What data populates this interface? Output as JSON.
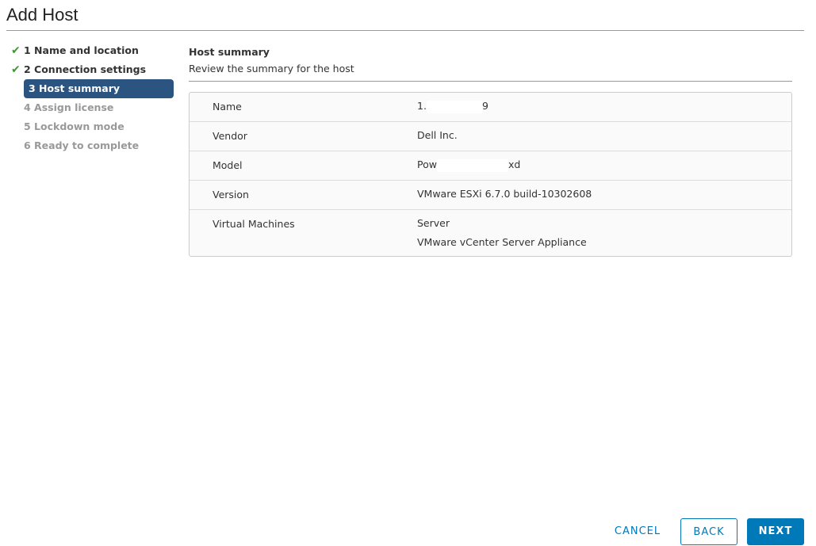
{
  "title": "Add Host",
  "steps": [
    {
      "label": "1 Name and location",
      "state": "done"
    },
    {
      "label": "2 Connection settings",
      "state": "done"
    },
    {
      "label": "3 Host summary",
      "state": "active"
    },
    {
      "label": "4 Assign license",
      "state": "todo"
    },
    {
      "label": "5 Lockdown mode",
      "state": "todo"
    },
    {
      "label": "6 Ready to complete",
      "state": "todo"
    }
  ],
  "check_icon": "✔",
  "main": {
    "heading": "Host summary",
    "subtitle": "Review the summary for the host"
  },
  "summary": {
    "name": {
      "label": "Name",
      "prefix": "1.",
      "suffix": "9"
    },
    "vendor": {
      "label": "Vendor",
      "value": "Dell Inc."
    },
    "model": {
      "label": "Model",
      "prefix": "Pow",
      "suffix": "xd"
    },
    "version": {
      "label": "Version",
      "value": "VMware ESXi 6.7.0 build-10302608"
    },
    "vms": {
      "label": "Virtual Machines",
      "values": [
        "Server",
        "VMware vCenter Server Appliance"
      ]
    }
  },
  "buttons": {
    "cancel": "CANCEL",
    "back": "BACK",
    "next": "NEXT"
  },
  "colors": {
    "accent": "#0079b8",
    "active_step": "#2b5480",
    "check": "#3c9a2f"
  }
}
